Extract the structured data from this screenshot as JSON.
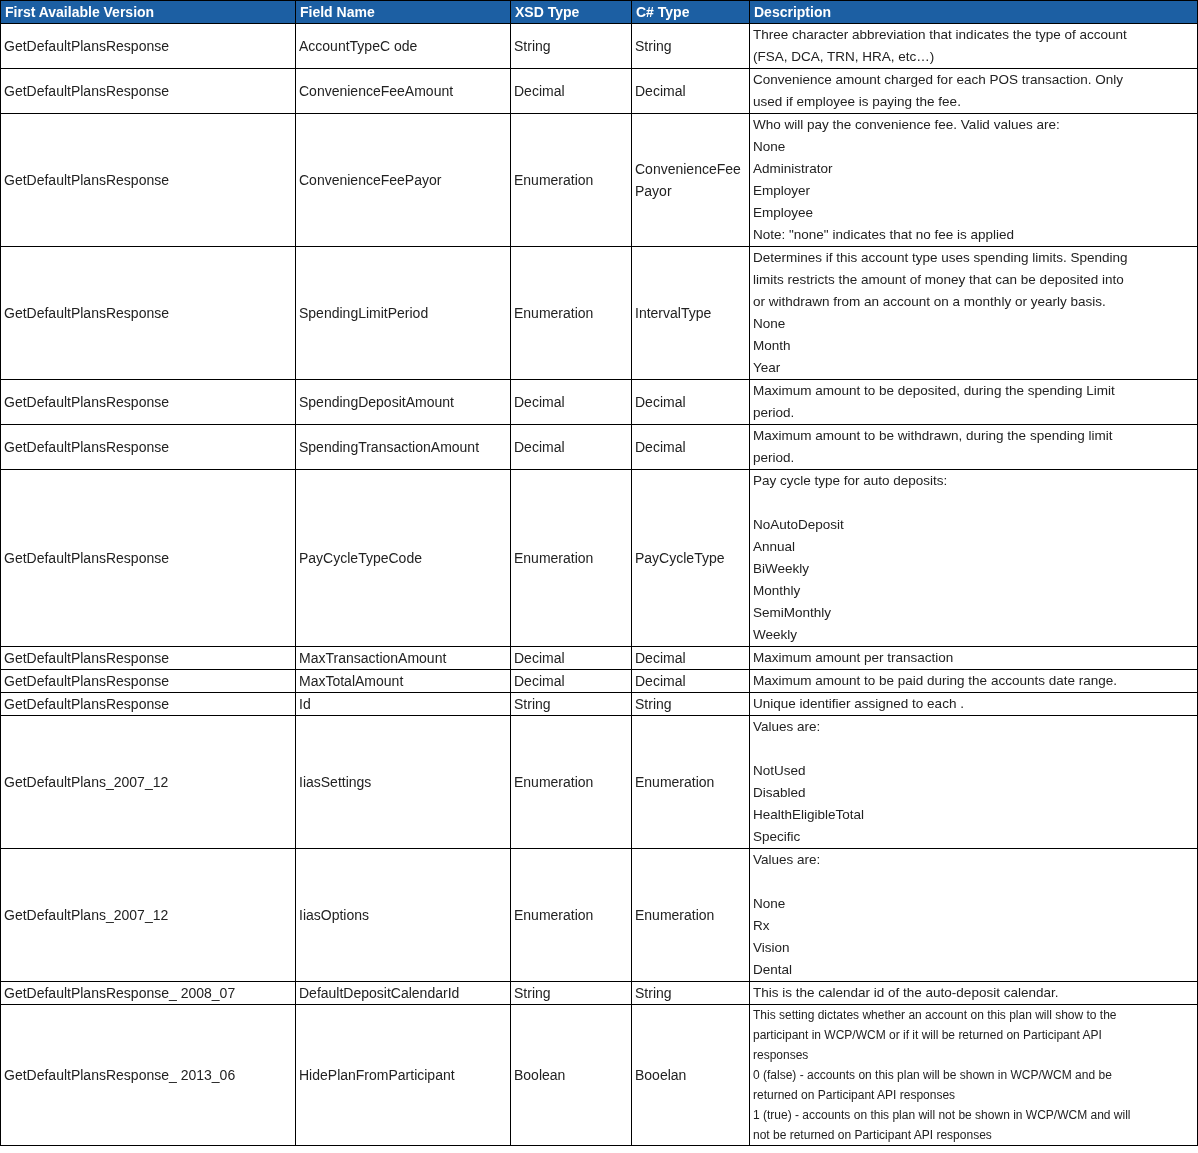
{
  "table": {
    "columns": [
      "First Available Version",
      "Field Name",
      "XSD Type",
      "C# Type",
      "Description"
    ],
    "rows": [
      {
        "version": "GetDefaultPlansResponse",
        "field": "AccountTypeC ode",
        "xsd": "String",
        "csharp": "String",
        "description": [
          "Three character abbreviation that indicates the type of account",
          "(FSA, DCA, TRN, HRA, etc…)"
        ]
      },
      {
        "version": "GetDefaultPlansResponse",
        "field": "ConvenienceFeeAmount",
        "xsd": "Decimal",
        "csharp": "Decimal",
        "description": [
          "Convenience amount charged for each POS transaction. Only",
          "used if employee is paying the fee."
        ]
      },
      {
        "version": "GetDefaultPlansResponse",
        "field": "ConvenienceFeePayor",
        "xsd": "Enumeration",
        "csharp": "ConvenienceFeePayor",
        "description": [
          "Who will pay the convenience fee. Valid values are:",
          "None",
          "Administrator",
          "Employer",
          "Employee",
          "Note: \"none\" indicates that no fee is applied"
        ]
      },
      {
        "version": "GetDefaultPlansResponse",
        "field": "SpendingLimitPeriod",
        "xsd": "Enumeration",
        "csharp": "IntervalType",
        "description": [
          "Determines if this account type uses spending limits. Spending",
          "limits restricts the amount of money that can be deposited into",
          "or withdrawn from an account on a monthly or yearly basis.",
          "None",
          "Month",
          "Year"
        ]
      },
      {
        "version": "GetDefaultPlansResponse",
        "field": "SpendingDepositAmount",
        "xsd": "Decimal",
        "csharp": "Decimal",
        "description": [
          "Maximum amount to be deposited, during the spending Limit",
          "period."
        ]
      },
      {
        "version": "GetDefaultPlansResponse",
        "field": "SpendingTransactionAmount",
        "xsd": "Decimal",
        "csharp": "Decimal",
        "description": [
          "Maximum amount to be withdrawn, during the spending limit",
          "period."
        ]
      },
      {
        "version": "GetDefaultPlansResponse",
        "field": "PayCycleTypeCode",
        "xsd": "Enumeration",
        "csharp": "PayCycleType",
        "gap_after_first": true,
        "description": [
          "Pay cycle type for auto deposits:",
          "NoAutoDeposit",
          "Annual",
          "BiWeekly",
          "Monthly",
          "SemiMonthly",
          "Weekly"
        ]
      },
      {
        "version": "GetDefaultPlansResponse",
        "field": "MaxTransactionAmount",
        "xsd": "Decimal",
        "csharp": "Decimal",
        "description": [
          "Maximum amount per transaction"
        ]
      },
      {
        "version": "GetDefaultPlansResponse",
        "field": "MaxTotalAmount",
        "xsd": "Decimal",
        "csharp": "Decimal",
        "description": [
          "Maximum amount to be paid during the accounts date range."
        ]
      },
      {
        "version": "GetDefaultPlansResponse",
        "field": "Id",
        "xsd": "String",
        "csharp": "String",
        "description": [
          "Unique identifier assigned to each ."
        ]
      },
      {
        "version": "GetDefaultPlans_2007_12",
        "field": "IiasSettings",
        "xsd": "Enumeration",
        "csharp": "Enumeration",
        "gap_after_first": true,
        "description": [
          "Values are:",
          "NotUsed",
          "Disabled",
          "HealthEligibleTotal",
          "Specific"
        ]
      },
      {
        "version": "GetDefaultPlans_2007_12",
        "field": "IiasOptions",
        "xsd": "Enumeration",
        "csharp": "Enumeration",
        "gap_after_first": true,
        "description": [
          "Values are:",
          "None",
          "Rx",
          "Vision",
          "Dental"
        ]
      },
      {
        "version": "GetDefaultPlansResponse_ 2008_07",
        "field": "DefaultDepositCalendarId",
        "xsd": "String",
        "csharp": "String",
        "description": [
          "This is the calendar id of the auto-deposit calendar."
        ]
      },
      {
        "version": "GetDefaultPlansResponse_ 2013_06",
        "field": "HidePlanFromParticipant",
        "xsd": "Boolean",
        "csharp": "Booelan",
        "small_text": true,
        "description": [
          "This setting dictates whether an account on this plan will show to the",
          "participant in WCP/WCM or if it will be returned on Participant API",
          "responses",
          "0  (false) - accounts on this plan will be shown in WCP/WCM and be",
          "returned on Participant API responses",
          "1 (true) - accounts on this plan will not be shown in WCP/WCM and will",
          "not be returned on Participant API responses"
        ]
      }
    ]
  }
}
